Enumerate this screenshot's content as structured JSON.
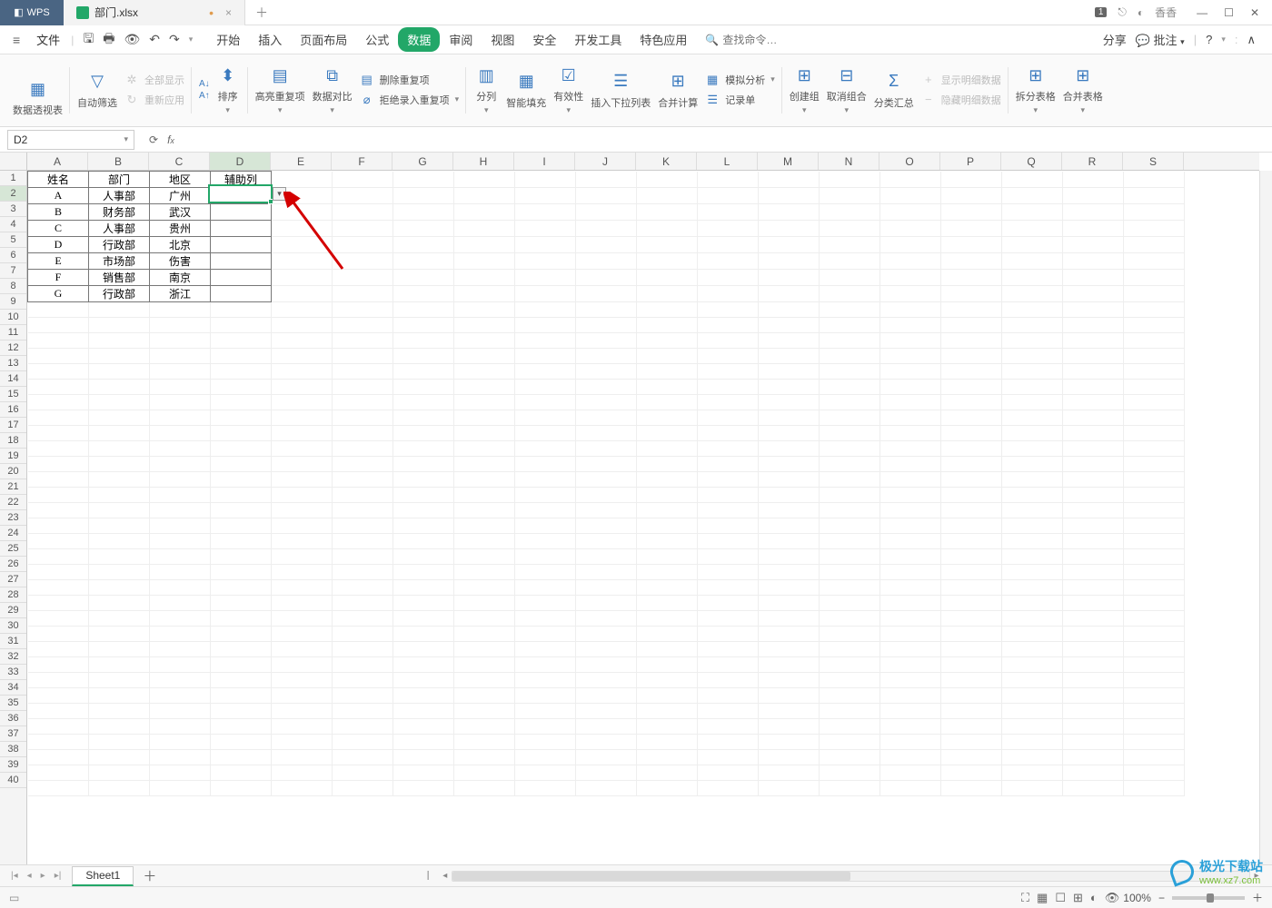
{
  "app": {
    "brand": "WPS"
  },
  "tab": {
    "filename": "部门.xlsx"
  },
  "titlebar_right": {
    "badge": "1",
    "user": "香香"
  },
  "menubar": {
    "file": "文件",
    "tabs": [
      "开始",
      "插入",
      "页面布局",
      "公式",
      "数据",
      "审阅",
      "视图",
      "安全",
      "开发工具",
      "特色应用"
    ],
    "active_index": 4,
    "search_placeholder": "查找命令…",
    "share": "分享",
    "annotate": "批注"
  },
  "ribbon": {
    "pivot": "数据透视表",
    "autofilter": "自动筛选",
    "showall": "全部显示",
    "reapply": "重新应用",
    "sort": "排序",
    "highlight_dup": "高亮重复项",
    "compare": "数据对比",
    "remove_dup": "删除重复项",
    "reject_dup": "拒绝录入重复项",
    "text_to_col": "分列",
    "flash_fill": "智能填充",
    "validation": "有效性",
    "insert_dropdown": "插入下拉列表",
    "consolidate": "合并计算",
    "whatif": "模拟分析",
    "form": "记录单",
    "group": "创建组",
    "ungroup": "取消组合",
    "subtotal": "分类汇总",
    "show_detail": "显示明细数据",
    "hide_detail": "隐藏明细数据",
    "split": "拆分表格",
    "merge": "合并表格"
  },
  "namebox": {
    "value": "D2"
  },
  "columns": [
    "A",
    "B",
    "C",
    "D",
    "E",
    "F",
    "G",
    "H",
    "I",
    "J",
    "K",
    "L",
    "M",
    "N",
    "O",
    "P",
    "Q",
    "R",
    "S"
  ],
  "row_count": 40,
  "selected": {
    "row": 2,
    "col": 3
  },
  "chart_data": {
    "type": "table",
    "headers": [
      "姓名",
      "部门",
      "地区",
      "辅助列"
    ],
    "rows": [
      [
        "A",
        "人事部",
        "广州",
        ""
      ],
      [
        "B",
        "财务部",
        "武汉",
        ""
      ],
      [
        "C",
        "人事部",
        "贵州",
        ""
      ],
      [
        "D",
        "行政部",
        "北京",
        ""
      ],
      [
        "E",
        "市场部",
        "伤害",
        ""
      ],
      [
        "F",
        "销售部",
        "南京",
        ""
      ],
      [
        "G",
        "行政部",
        "浙江",
        ""
      ]
    ]
  },
  "sheet": {
    "name": "Sheet1"
  },
  "statusbar": {
    "zoom": "100%"
  },
  "watermark": {
    "t1": "极光下载站",
    "t2": "www.xz7.com"
  }
}
